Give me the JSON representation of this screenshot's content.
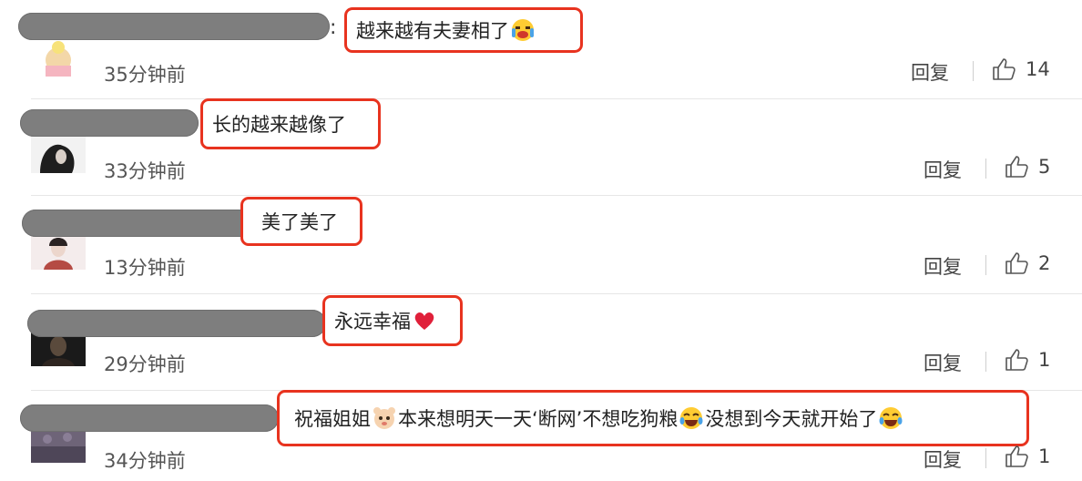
{
  "comments": [
    {
      "text_a": "越来越有夫妻相了",
      "time": "35分钟前",
      "reply": "回复",
      "likes": "14",
      "emoji_a": "crying-laugh-emoji"
    },
    {
      "text_a": "长的越来越像了",
      "time": "33分钟前",
      "reply": "回复",
      "likes": "5"
    },
    {
      "text_a": "美了美了",
      "time": "13分钟前",
      "reply": "回复",
      "likes": "2"
    },
    {
      "text_a": "永远幸福",
      "time": "29分钟前",
      "reply": "回复",
      "likes": "1",
      "emoji_a": "red-heart-emoji"
    },
    {
      "text_a": "祝福姐姐",
      "text_b": "本来想明天一天‘断网’不想吃狗粮",
      "text_c": "没想到今天就开始了",
      "time": "34分钟前",
      "reply": "回复",
      "likes": "1",
      "emoji_a": "cute-face-emoji",
      "emoji_b": "tears-of-joy-emoji"
    }
  ],
  "colors": {
    "highlight_border": "#e8331f",
    "divider": "#e6e6e6",
    "redaction": "#7e7e7e"
  }
}
